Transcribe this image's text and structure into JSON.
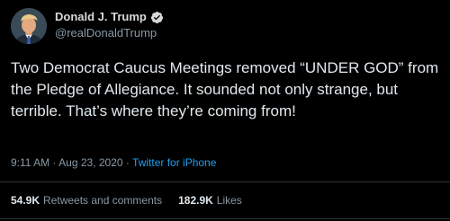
{
  "author": {
    "display_name": "Donald J. Trump",
    "handle": "@realDonaldTrump",
    "verified_icon": "verified-badge-icon",
    "avatar_icon": "profile-photo"
  },
  "tweet": {
    "text": "Two Democrat Caucus Meetings removed “UNDER GOD” from the Pledge of Allegiance. It sounded not only strange, but terrible. That’s where they’re coming from!",
    "time": "9:11 AM",
    "date": "Aug 23, 2020",
    "separator": "·",
    "source": "Twitter for iPhone"
  },
  "stats": {
    "retweets_count": "54.9K",
    "retweets_label": "Retweets and comments",
    "likes_count": "182.9K",
    "likes_label": "Likes"
  },
  "colors": {
    "background": "#000000",
    "accent": "#1da1f2",
    "secondary_text": "#8899a6",
    "primary_text": "#e1e8ed"
  }
}
